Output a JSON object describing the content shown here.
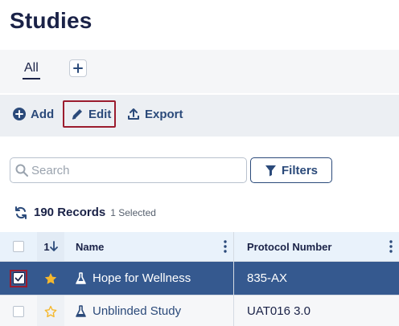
{
  "page": {
    "title": "Studies"
  },
  "tabs": {
    "all_label": "All",
    "add_tab_icon": "plus-icon"
  },
  "toolbar": {
    "add_label": "Add",
    "edit_label": "Edit",
    "export_label": "Export",
    "accent": "#2b4a7a",
    "highlight": "#9b1c2e"
  },
  "search": {
    "placeholder": "Search",
    "filters_label": "Filters"
  },
  "records": {
    "count_label": "190 Records",
    "selected_label": "1 Selected"
  },
  "table": {
    "headers": {
      "sort": "1",
      "name": "Name",
      "protocol": "Protocol Number"
    },
    "rows": [
      {
        "name": "Hope for Wellness",
        "protocol": "835-AX",
        "selected": true,
        "favorite": true
      },
      {
        "name": "Unblinded Study",
        "protocol": "UAT016 3.0",
        "selected": false,
        "favorite": false
      }
    ],
    "selected_row_color": "#35598f"
  }
}
